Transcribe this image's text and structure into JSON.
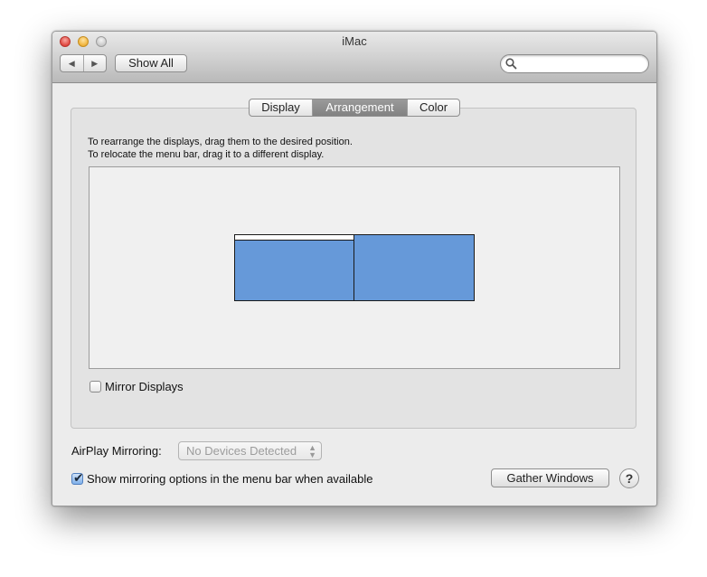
{
  "window": {
    "title": "iMac"
  },
  "toolbar": {
    "back_icon": "back-arrow-icon",
    "forward_icon": "forward-arrow-icon",
    "show_all_label": "Show All",
    "search_value": "",
    "search_icon": "magnifier-icon"
  },
  "tabs": [
    {
      "label": "Display",
      "active": false
    },
    {
      "label": "Arrangement",
      "active": true
    },
    {
      "label": "Color",
      "active": false
    }
  ],
  "arrangement": {
    "instruction_line1": "To rearrange the displays, drag them to the desired position.",
    "instruction_line2": "To relocate the menu bar, drag it to a different display.",
    "display_color": "#6699d9",
    "mirror_label": "Mirror Displays",
    "mirror_checked": false
  },
  "airplay": {
    "label": "AirPlay Mirroring:",
    "selected": "No Devices Detected",
    "enabled": false
  },
  "menu_bar_option": {
    "label": "Show mirroring options in the menu bar when available",
    "checked": true
  },
  "buttons": {
    "gather_label": "Gather Windows",
    "help_label": "?"
  }
}
